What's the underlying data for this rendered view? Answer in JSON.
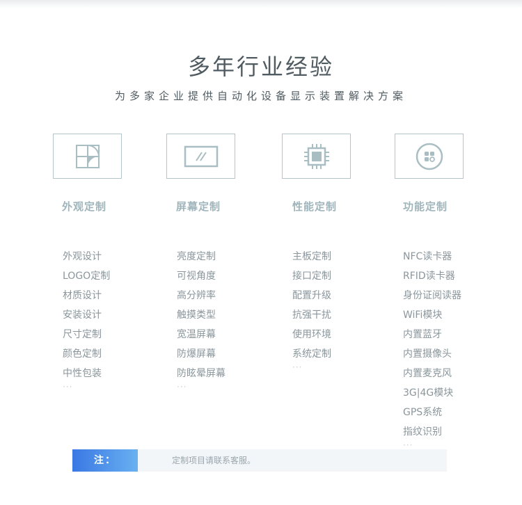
{
  "header": {
    "title": "多年行业经验",
    "subtitle": "为多家企业提供自动化设备显示装置解决方案"
  },
  "columns": [
    {
      "icon": "layout-grid-icon",
      "title": "外观定制",
      "items": [
        "外观设计",
        "LOGO定制",
        "材质设计",
        "安装设计",
        "尺寸定制",
        "颜色定制",
        "中性包装"
      ],
      "more": "···"
    },
    {
      "icon": "screen-icon",
      "title": "屏幕定制",
      "items": [
        "亮度定制",
        "可视角度",
        "高分辨率",
        "触摸类型",
        "宽温屏幕",
        "防爆屏幕",
        "防眩晕屏幕"
      ],
      "more": "···"
    },
    {
      "icon": "chip-icon",
      "title": "性能定制",
      "items": [
        "主板定制",
        "接口定制",
        "配置升级",
        "抗强干扰",
        "使用环境",
        "系统定制"
      ],
      "more": "···"
    },
    {
      "icon": "module-icon",
      "title": "功能定制",
      "items": [
        "NFC读卡器",
        "RFID读卡器",
        "身份证阅读器",
        "WiFi模块",
        "内置蓝牙",
        "内置摄像头",
        "内置麦克风",
        "3G|4G模块",
        "GPS系统",
        "指纹识别"
      ],
      "more": "···"
    }
  ],
  "note": {
    "label": "注：",
    "text": "定制项目请联系客服。"
  },
  "colors": {
    "icon": "#a9bec3",
    "border": "#b4c4c8",
    "accent_start": "#3a78e4",
    "accent_end": "#69b0f0"
  }
}
